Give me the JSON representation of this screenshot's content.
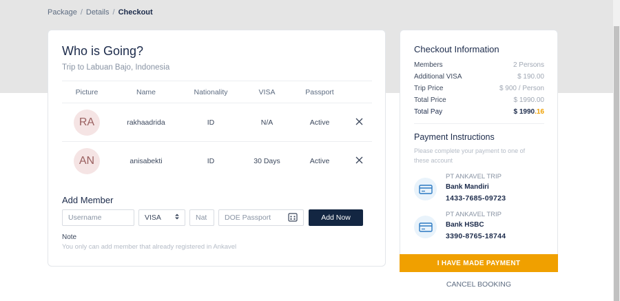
{
  "breadcrumb": {
    "items": [
      "Package",
      "Details"
    ],
    "current": "Checkout"
  },
  "members_card": {
    "title": "Who is Going?",
    "subtitle": "Trip to Labuan Bajo, Indonesia",
    "columns": [
      "Picture",
      "Name",
      "Nationality",
      "VISA",
      "Passport"
    ],
    "rows": [
      {
        "initials": "RA",
        "name": "rakhaadrida",
        "nationality": "ID",
        "visa": "N/A",
        "passport": "Active"
      },
      {
        "initials": "AN",
        "name": "anisabekti",
        "nationality": "ID",
        "visa": "30 Days",
        "passport": "Active"
      }
    ]
  },
  "add_member": {
    "title": "Add Member",
    "username_placeholder": "Username",
    "visa_value": "VISA",
    "nat_placeholder": "Nat",
    "doe_placeholder": "DOE Passport",
    "button": "Add Now",
    "note_label": "Note",
    "note_text": "You only can add member that already registered in Ankavel"
  },
  "checkout": {
    "title": "Checkout Information",
    "rows": [
      {
        "label": "Members",
        "value": "2 Persons"
      },
      {
        "label": "Additional VISA",
        "value": "$ 190.00"
      },
      {
        "label": "Trip Price",
        "value": "$ 900 / Person"
      },
      {
        "label": "Total Price",
        "value": "$ 1990.00"
      }
    ],
    "total_pay": {
      "label": "Total Pay",
      "main": "$ 1990",
      "cents": ".16"
    }
  },
  "payment": {
    "title": "Payment Instructions",
    "subtitle": "Please complete your payment to one of these account",
    "banks": [
      {
        "owner": "PT ANKAVEL TRIP",
        "bank": "Bank Mandiri",
        "account": "1433-7685-09723"
      },
      {
        "owner": "PT ANKAVEL TRIP",
        "bank": "Bank HSBC",
        "account": "3390-8765-18744"
      }
    ]
  },
  "actions": {
    "pay": "I HAVE MADE PAYMENT",
    "cancel": "CANCEL BOOKING"
  },
  "colors": {
    "primary": "#132642",
    "accent": "#f0a000",
    "band": "#e5e5e5"
  }
}
